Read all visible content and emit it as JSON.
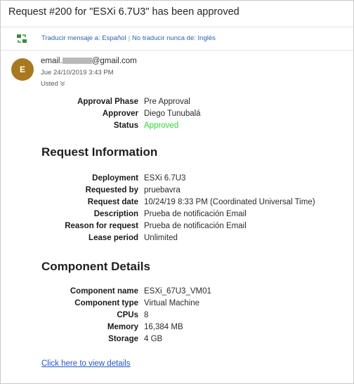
{
  "subject": "Request #200 for \"ESXi 6.7U3\" has been approved",
  "translate_bar": {
    "icon": "translate-icon",
    "translate_link": "Traducir mensaje a: Español",
    "separator": "|",
    "never_link": "No traducir nunca de: Inglés"
  },
  "sender": {
    "avatar_letter": "E",
    "avatar_color": "#a8791e",
    "email_prefix": "email.",
    "email_suffix": "@gmail.com",
    "date": "Jue 24/10/2019 3:43 PM",
    "to": "Usted"
  },
  "approval": [
    {
      "label": "Approval Phase",
      "value": "Pre Approval"
    },
    {
      "label": "Approver",
      "value": "Diego Tunubalá"
    },
    {
      "label": "Status",
      "value": "Approved",
      "color": "#2cd62c"
    }
  ],
  "request_info": {
    "heading": "Request Information",
    "rows": [
      {
        "label": "Deployment",
        "value": "ESXi 6.7U3"
      },
      {
        "label": "Requested by",
        "value": "pruebavra"
      },
      {
        "label": "Request date",
        "value": "10/24/19 8:33 PM (Coordinated Universal Time)"
      },
      {
        "label": "Description",
        "value": "Prueba de notificación Email"
      },
      {
        "label": "Reason for request",
        "value": "Prueba de notificación Email"
      },
      {
        "label": "Lease period",
        "value": "Unlimited"
      }
    ]
  },
  "component_details": {
    "heading": "Component Details",
    "rows": [
      {
        "label": "Component name",
        "value": "ESXi_67U3_VM01"
      },
      {
        "label": "Component type",
        "value": "Virtual Machine"
      },
      {
        "label": "CPUs",
        "value": "8"
      },
      {
        "label": "Memory",
        "value": "16,384 MB"
      },
      {
        "label": "Storage",
        "value": "4 GB"
      }
    ]
  },
  "details_link": "Click here to view details"
}
